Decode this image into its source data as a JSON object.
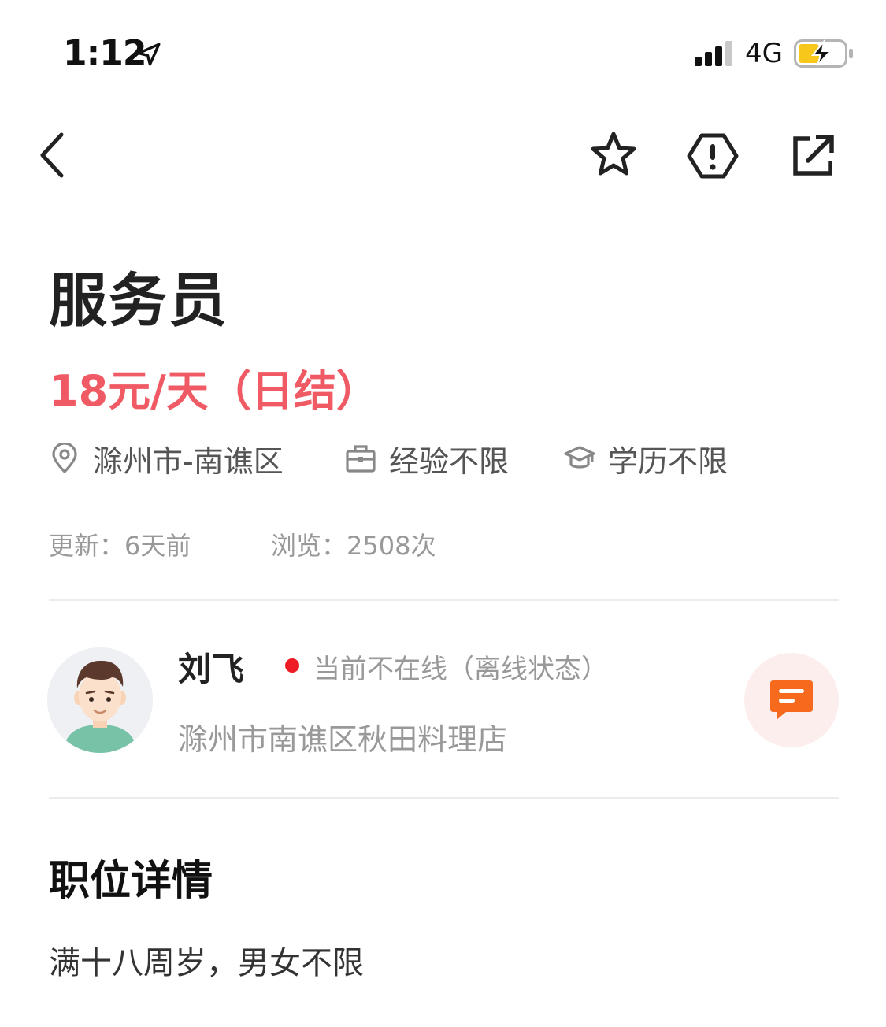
{
  "status_bar": {
    "time": "1:12",
    "network": "4G",
    "location_icon": "location-arrow-icon",
    "signal_icon": "cellular-signal-icon",
    "battery_icon": "battery-charging-icon",
    "battery_color": "#f7c71b"
  },
  "nav": {
    "back_icon": "chevron-left-icon",
    "favorite_icon": "star-outline-icon",
    "report_icon": "exclamation-hexagon-icon",
    "share_icon": "share-external-icon"
  },
  "job": {
    "title": "服务员",
    "salary": "18元/天（日结）",
    "salary_color": "#f05a64",
    "requirements": [
      {
        "icon": "location-pin-icon",
        "label": "滁州市-南谯区"
      },
      {
        "icon": "briefcase-icon",
        "label": "经验不限"
      },
      {
        "icon": "graduation-cap-icon",
        "label": "学历不限"
      }
    ],
    "updated": "更新：6天前",
    "views": "浏览：2508次"
  },
  "recruiter": {
    "name": "刘飞",
    "status": "当前不在线（离线状态）",
    "status_color": "#ee1c25",
    "company": "滁州市南谯区秋田料理店",
    "chat_icon": "chat-bubble-icon",
    "chat_color": "#f56a1d"
  },
  "details": {
    "section_title": "职位详情",
    "lines": [
      "满十八周岁，男女不限"
    ]
  }
}
